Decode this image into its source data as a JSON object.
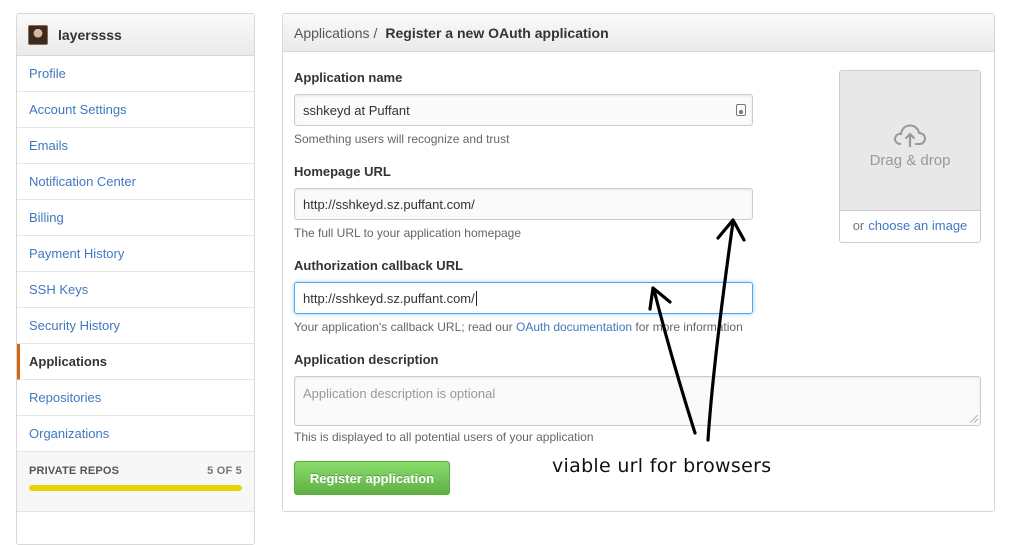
{
  "sidebar": {
    "username": "layerssss",
    "items": [
      {
        "label": "Profile"
      },
      {
        "label": "Account Settings"
      },
      {
        "label": "Emails"
      },
      {
        "label": "Notification Center"
      },
      {
        "label": "Billing"
      },
      {
        "label": "Payment History"
      },
      {
        "label": "SSH Keys"
      },
      {
        "label": "Security History"
      },
      {
        "label": "Applications",
        "selected": true
      },
      {
        "label": "Repositories"
      },
      {
        "label": "Organizations"
      }
    ],
    "private_repos": {
      "label": "PRIVATE REPOS",
      "count": "5 OF 5",
      "fill_fraction": 1.0
    },
    "accent_color": "#d26911",
    "link_color": "#4078c0"
  },
  "breadcrumb": {
    "parent": "Applications",
    "separator": "/",
    "current": "Register a new OAuth application"
  },
  "form": {
    "app_name": {
      "label": "Application name",
      "value": "sshkeyd at Puffant",
      "hint": "Something users will recognize and trust"
    },
    "homepage_url": {
      "label": "Homepage URL",
      "value": "http://sshkeyd.sz.puffant.com/",
      "hint": "The full URL to your application homepage"
    },
    "callback_url": {
      "label": "Authorization callback URL",
      "value": "http://sshkeyd.sz.puffant.com/",
      "hint_before": "Your application's callback URL; read our",
      "hint_link": "OAuth documentation",
      "hint_after": "for more information"
    },
    "description": {
      "label": "Application description",
      "placeholder": "Application description is optional",
      "hint": "This is displayed to all potential users of your application"
    },
    "submit_label": "Register application",
    "submit_color": "#60b044"
  },
  "upload": {
    "drop_text": "Drag & drop",
    "or_text": "or",
    "choose_link": "choose an image"
  },
  "annotation": {
    "text": "viable url for browsers"
  }
}
